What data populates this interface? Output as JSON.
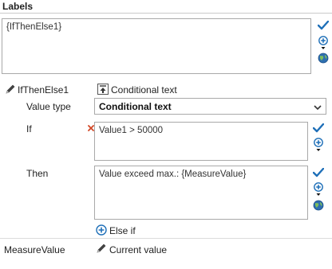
{
  "header": {
    "title": "Labels"
  },
  "labels_box": {
    "value": "{IfThenElse1}"
  },
  "item": {
    "name": "IfThenElse1",
    "mode_label": "Conditional text"
  },
  "value_type": {
    "label": "Value type",
    "selected": "Conditional text"
  },
  "if_row": {
    "label": "If",
    "value": "Value1 > 50000"
  },
  "then_row": {
    "label": "Then",
    "value": "Value exceed max.: {MeasureValue}"
  },
  "else_if": {
    "label": "Else if"
  },
  "measure": {
    "name": "MeasureValue",
    "value_label": "Current value"
  },
  "colors": {
    "accent": "#1e6fb8",
    "error": "#d24726"
  }
}
